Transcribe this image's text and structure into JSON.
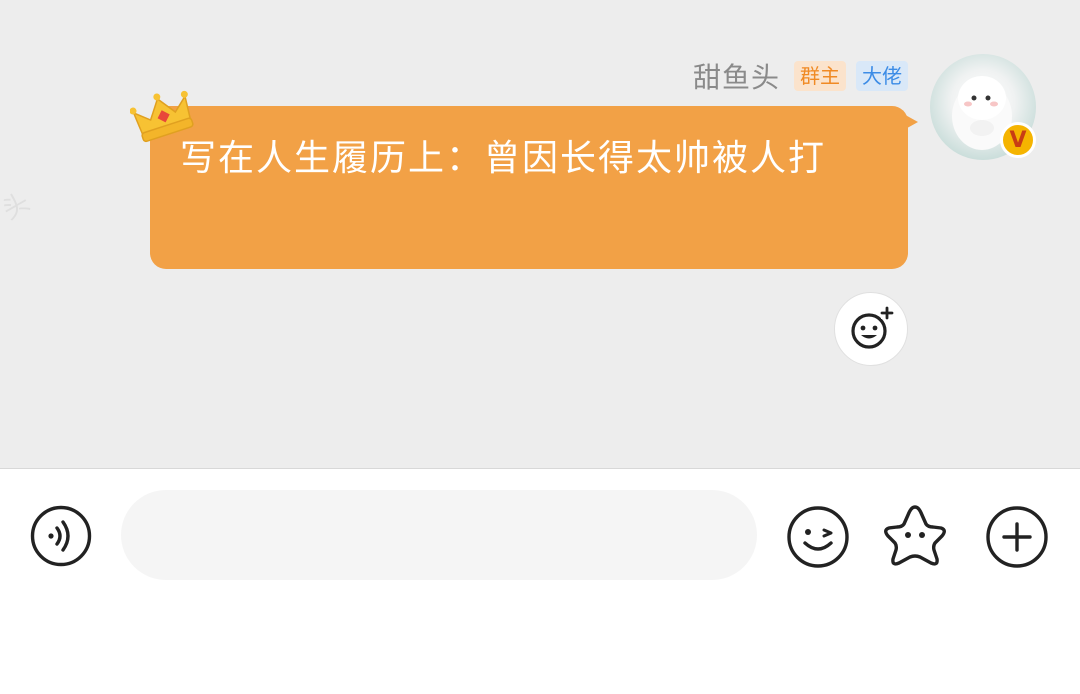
{
  "message": {
    "sender_name": "甜鱼头",
    "badges": {
      "owner": "群主",
      "boss": "大佬"
    },
    "text": "写在人生履历上：曾因长得太帅被人打",
    "bubble_color": "#f2a146"
  },
  "watermark": "头",
  "avatar_badge": "V",
  "icons": {
    "crown": "crown-icon",
    "add_reaction": "add-reaction-icon",
    "voice": "voice-icon",
    "emoji": "emoji-icon",
    "sticker": "star-sticker-icon",
    "more": "plus-icon"
  },
  "input": {
    "value": "",
    "placeholder": ""
  }
}
